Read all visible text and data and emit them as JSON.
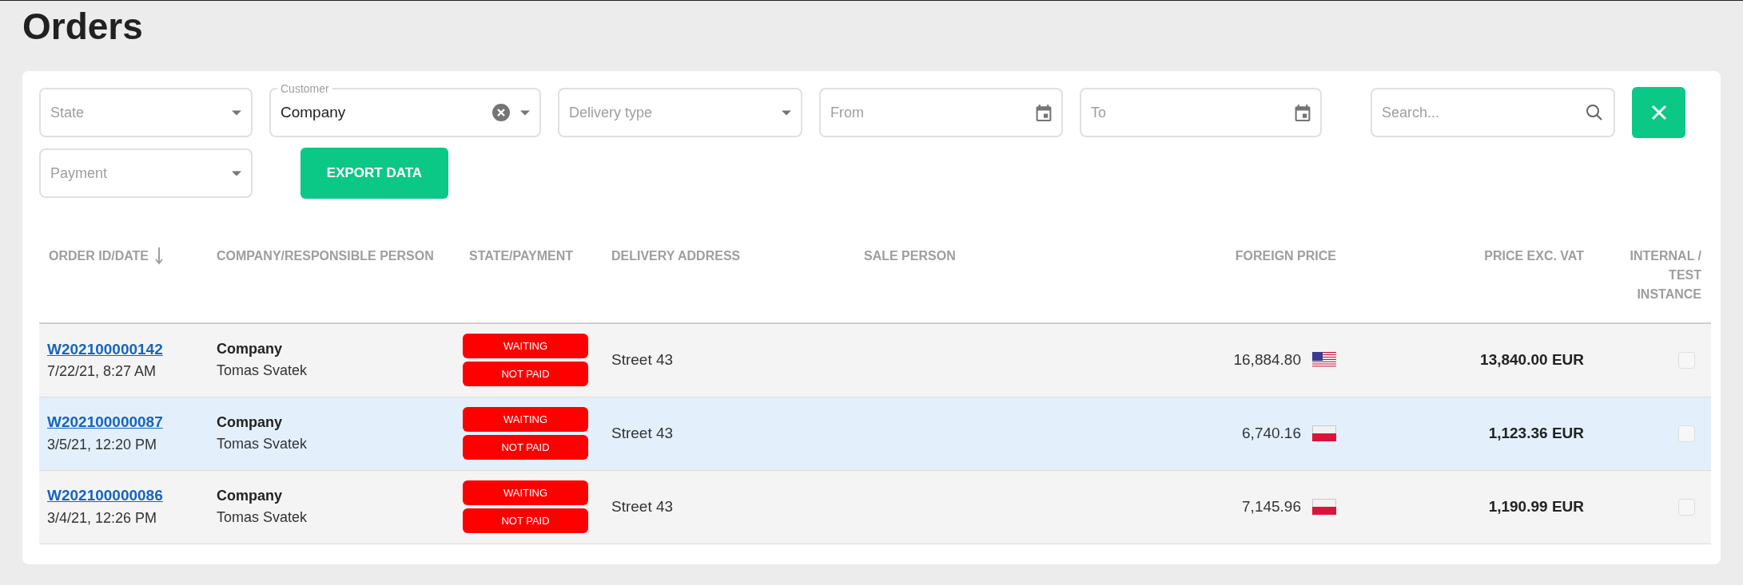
{
  "page": {
    "title": "Orders"
  },
  "filters": [
    {
      "kind": "select",
      "placeholder": "State"
    },
    {
      "kind": "select",
      "label": "Customer",
      "value": "Company"
    },
    {
      "kind": "select",
      "placeholder": "Delivery type"
    },
    {
      "kind": "date",
      "placeholder": "From"
    },
    {
      "kind": "date",
      "placeholder": "To"
    },
    {
      "kind": "search",
      "placeholder": "Search..."
    },
    {
      "kind": "clear"
    },
    {
      "kind": "select",
      "placeholder": "Payment"
    },
    {
      "kind": "export",
      "label": "EXPORT DATA"
    }
  ],
  "table": {
    "columns": [
      {
        "label": "ORDER ID/DATE",
        "sorted": true
      },
      {
        "label": "COMPANY/RESPONSIBLE PERSON",
        "sorted": false
      },
      {
        "label": "STATE/PAYMENT",
        "sorted": false
      },
      {
        "label": "DELIVERY ADDRESS",
        "sorted": false
      },
      {
        "label": "SALE PERSON",
        "sorted": false
      },
      {
        "label": "FOREIGN PRICE",
        "sorted": false
      },
      {
        "label": "PRICE EXC. VAT",
        "sorted": false
      },
      {
        "label": "INTERNAL / TEST INSTANCE",
        "sorted": false
      }
    ],
    "rows": [
      {
        "highlighted": false,
        "order_id": "W202100000142",
        "date": "7/22/21, 8:27 AM",
        "company": "Company",
        "person": "Tomas Svatek",
        "state": "WAITING",
        "payment": "NOT PAID",
        "address": "Street 43",
        "foreign_price": "16,884.80",
        "flag": {
          "kind": "us"
        },
        "price": "13,840.00 EUR",
        "internal": {
          "checked": false,
          "disabled": true
        }
      },
      {
        "highlighted": true,
        "order_id": "W202100000087",
        "date": "3/5/21, 12:20 PM",
        "company": "Company",
        "person": "Tomas Svatek",
        "state": "WAITING",
        "payment": "NOT PAID",
        "address": "Street 43",
        "foreign_price": "6,740.16",
        "flag": {
          "kind": "pl"
        },
        "price": "1,123.36 EUR",
        "internal": {
          "checked": false,
          "disabled": true
        }
      },
      {
        "highlighted": false,
        "order_id": "W202100000086",
        "date": "3/4/21, 12:26 PM",
        "company": "Company",
        "person": "Tomas Svatek",
        "state": "WAITING",
        "payment": "NOT PAID",
        "address": "Street 43",
        "foreign_price": "7,145.96",
        "flag": {
          "kind": "pl"
        },
        "price": "1,190.99 EUR",
        "internal": {
          "checked": false,
          "disabled": true
        }
      }
    ]
  }
}
